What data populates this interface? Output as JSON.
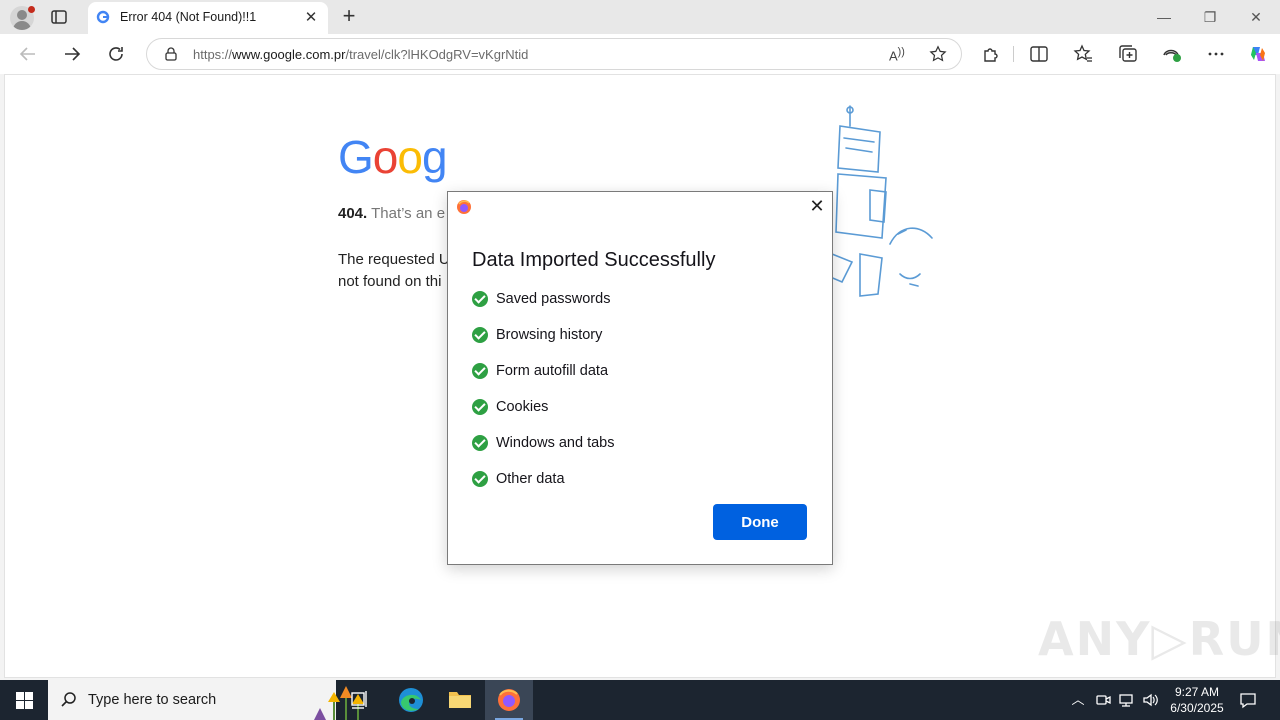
{
  "browser": {
    "tab": {
      "title": "Error 404 (Not Found)!!1"
    },
    "address": {
      "url_prefix": "https://",
      "url_host": "www.google.com.pr",
      "url_path": "/travel/clk?lHKOdgRV=vKgrNtid"
    }
  },
  "page": {
    "logo": [
      "G",
      "o",
      "o",
      "g"
    ],
    "line1_code": "404.",
    "line1_text": " That’s an e",
    "line2a": "The requested U",
    "line2b": "not found on thi"
  },
  "dialog": {
    "title": "Data Imported Successfully",
    "items": [
      {
        "label": "Saved passwords"
      },
      {
        "label": "Browsing history"
      },
      {
        "label": "Form autofill data"
      },
      {
        "label": "Cookies"
      },
      {
        "label": "Windows and tabs"
      },
      {
        "label": "Other data"
      }
    ],
    "done_label": "Done"
  },
  "watermark": "ANY▷RUN",
  "taskbar": {
    "search_placeholder": "Type here to search",
    "time": "9:27 AM",
    "date": "6/30/2025"
  },
  "colors": {
    "accent": "#0061e0",
    "check": "#2ea043",
    "taskbar": "#1c2530"
  }
}
